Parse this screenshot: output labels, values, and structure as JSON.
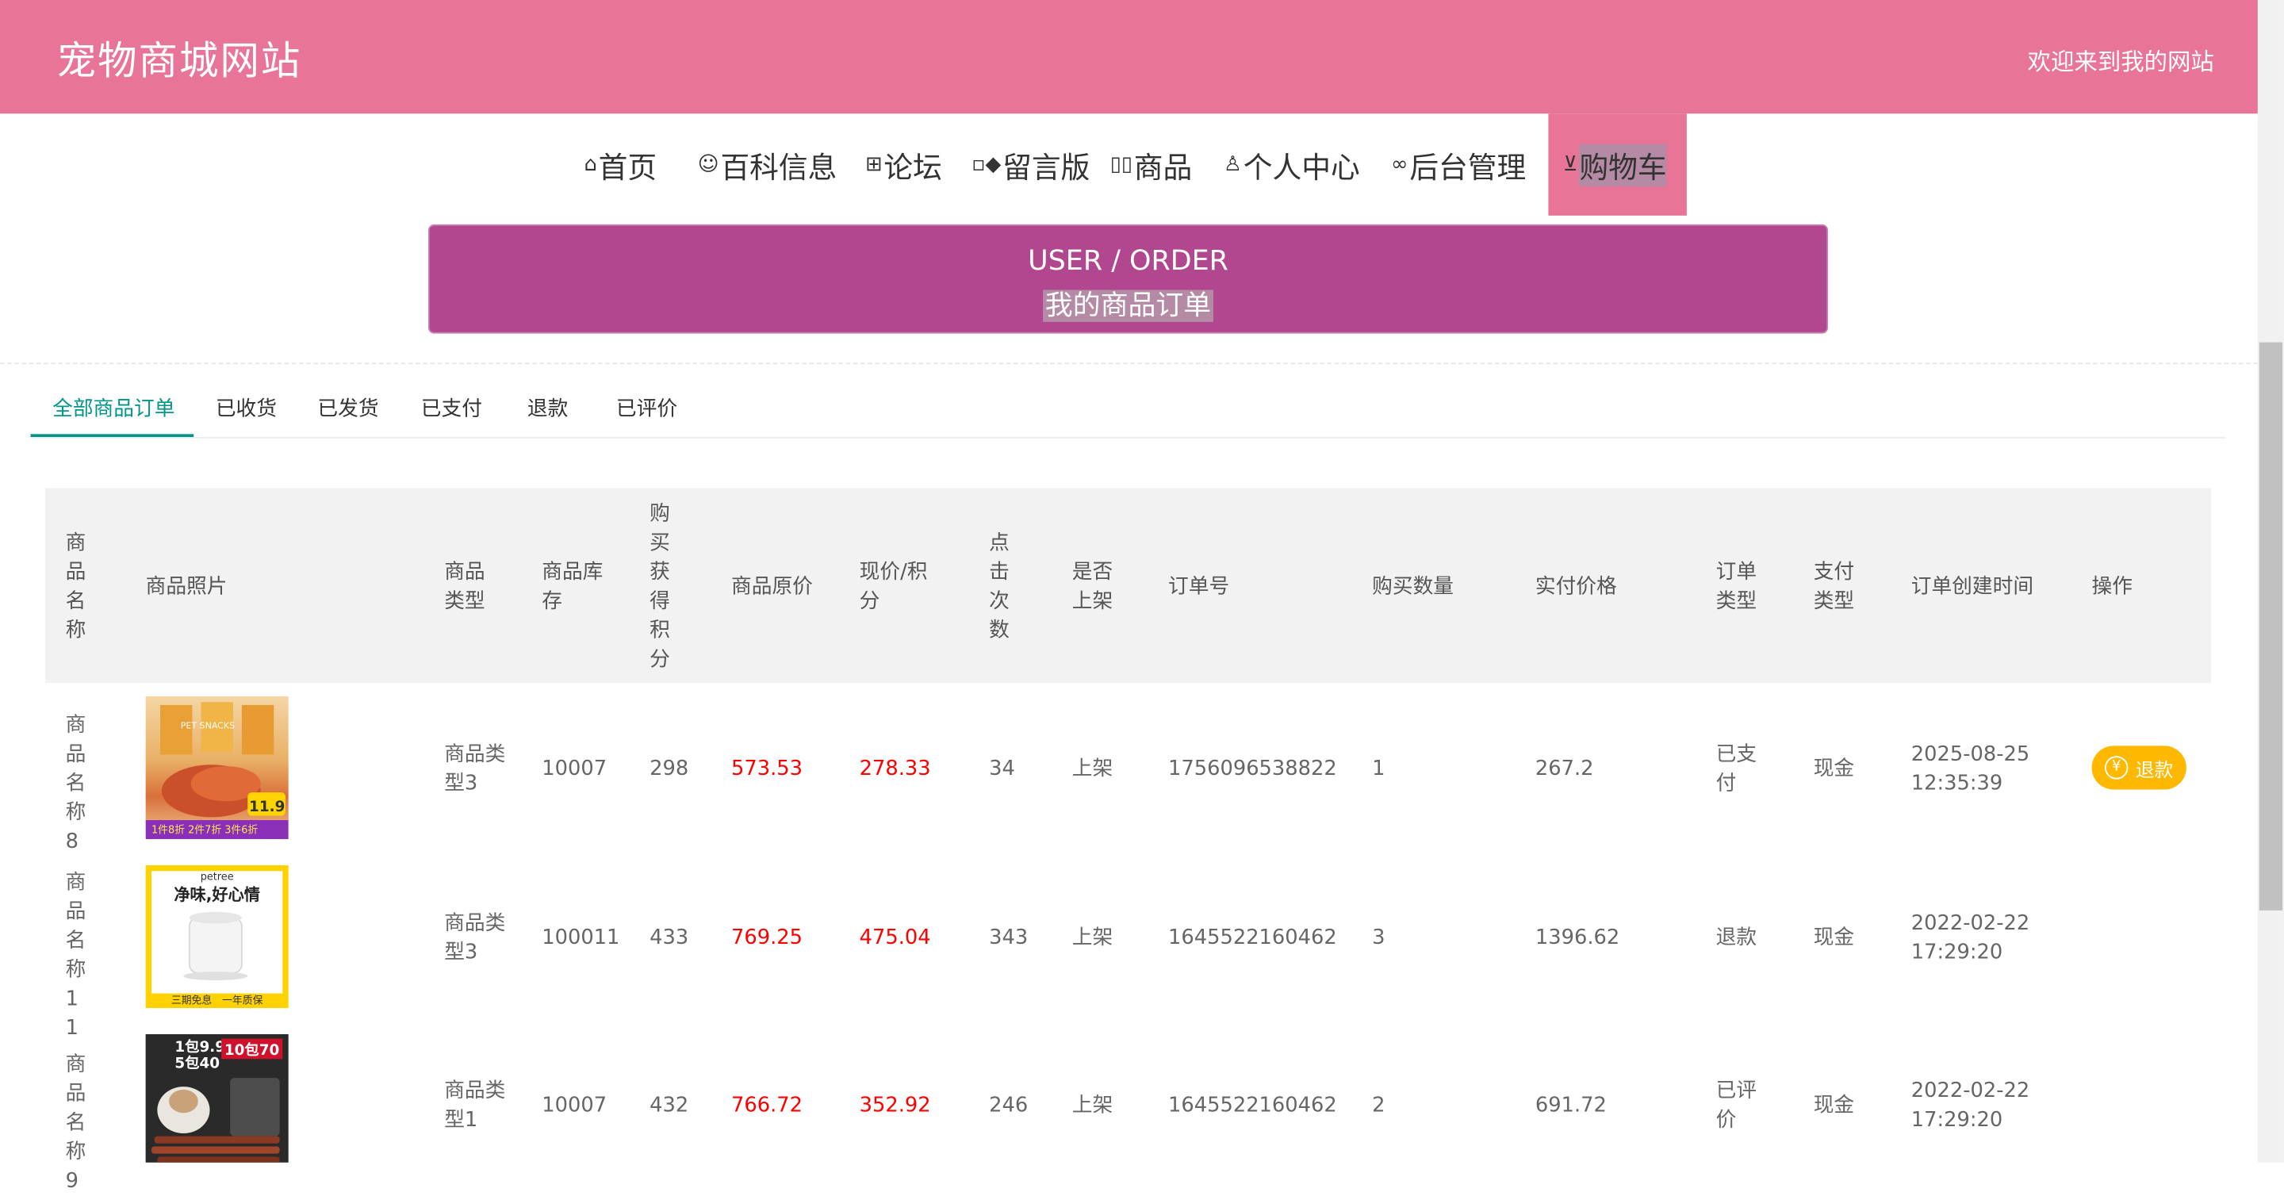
{
  "header": {
    "site_title": "宠物商城网站",
    "welcome": "欢迎来到我的网站"
  },
  "nav": {
    "items": [
      {
        "label": "首页",
        "icon": "home-icon",
        "glyph": "⌂"
      },
      {
        "label": "百科信息",
        "icon": "smile-icon",
        "glyph": "☺"
      },
      {
        "label": "论坛",
        "icon": "gift-icon",
        "glyph": "⊞"
      },
      {
        "label": "留言版",
        "icon": "apps-icon",
        "glyph": "▫◆"
      },
      {
        "label": "商品",
        "icon": "product-icon",
        "glyph": "▯▯"
      },
      {
        "label": "个人中心",
        "icon": "user-icon",
        "glyph": "♙"
      },
      {
        "label": "后台管理",
        "icon": "link-icon",
        "glyph": "∞"
      },
      {
        "label": "购物车",
        "icon": "cart-icon",
        "glyph": "⊻"
      }
    ],
    "active": "购物车"
  },
  "banner": {
    "title_en": "USER / ORDER",
    "title_cn": "我的商品订单"
  },
  "tabs": [
    "全部商品订单",
    "已收货",
    "已发货",
    "已支付",
    "退款",
    "已评价"
  ],
  "active_tab": "全部商品订单",
  "table": {
    "headers": {
      "name": "商品名称",
      "photo": "商品照片",
      "type": "商品类型",
      "stock": "商品库存",
      "points": "购买获得积分",
      "orig_price": "商品原价",
      "cur_price": "现价/积分",
      "clicks": "点击次数",
      "listed": "是否上架",
      "order_no": "订单号",
      "qty": "购买数量",
      "paid": "实付价格",
      "order_type": "订单类型",
      "pay_type": "支付类型",
      "created": "订单创建时间",
      "action": "操作"
    },
    "rows": [
      {
        "name": "商品名称8",
        "type": "商品类型3",
        "stock": "10007",
        "points": "298",
        "orig_price": "573.53",
        "cur_price": "278.33",
        "clicks": "34",
        "listed": "上架",
        "order_no": "1756096538822",
        "qty": "1",
        "paid": "267.2",
        "order_type": "已支付",
        "pay_type": "现金",
        "created_date": "2025-08-25",
        "created_time": "12:35:39",
        "action": "退款",
        "img_text_top": "PET SNACKS",
        "img_price": "11.9",
        "img_text_bottom": "1件8折 2件7折 3件6折"
      },
      {
        "name": "商品名称11",
        "type": "商品类型3",
        "stock": "100011",
        "points": "433",
        "orig_price": "769.25",
        "cur_price": "475.04",
        "clicks": "343",
        "listed": "上架",
        "order_no": "1645522160462",
        "qty": "3",
        "paid": "1396.62",
        "order_type": "退款",
        "pay_type": "现金",
        "created_date": "2022-02-22",
        "created_time": "17:29:20",
        "action": "",
        "img_brand": "petree",
        "img_slogan": "净味,好心情",
        "img_text_bottom": "三期免息　一年质保"
      },
      {
        "name": "商品名称9",
        "type": "商品类型1",
        "stock": "10007",
        "points": "432",
        "orig_price": "766.72",
        "cur_price": "352.92",
        "clicks": "246",
        "listed": "上架",
        "order_no": "1645522160462",
        "qty": "2",
        "paid": "691.72",
        "order_type": "已评价",
        "pay_type": "现金",
        "created_date": "2022-02-22",
        "created_time": "17:29:20",
        "action": "",
        "img_promo1": "1包9.9",
        "img_promo2": "5包40",
        "img_promo3": "10包70"
      }
    ]
  }
}
